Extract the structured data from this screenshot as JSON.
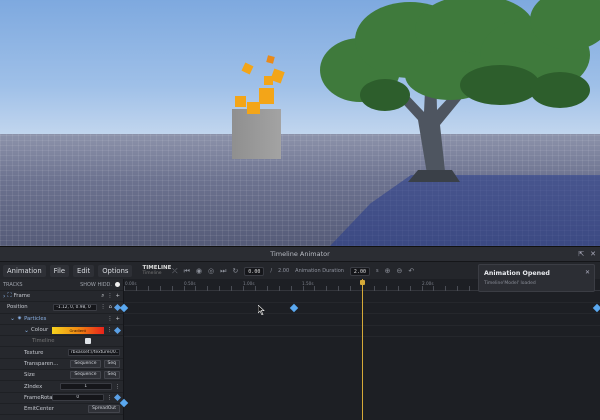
{
  "window": {
    "title": "Timeline Animator"
  },
  "menu": [
    "Animation",
    "File",
    "Edit",
    "Options"
  ],
  "timeline_label": {
    "title": "TIMELINE",
    "subtitle": "Timeline"
  },
  "transport": {
    "current_time": "0.00",
    "separator": "/",
    "total_time": "2.00",
    "duration_label": "Animation Duration",
    "duration_value": "2.00",
    "duration_unit": "s"
  },
  "tracks": {
    "header": "TRACKS",
    "show_hidden": "SHOW HIDD.",
    "frame": "Frame",
    "position": {
      "label": "Position",
      "value": "-1.12, 0, 0.98, 0"
    },
    "particles": "Particles",
    "colour": {
      "label": "Colour",
      "value": "Gradient"
    },
    "timeline_sub": "Timeline",
    "texture": {
      "label": "Texture",
      "value": "rbxasset://textures/0..."
    },
    "transparency": {
      "label": "Transparen...",
      "btn1": "Sequence",
      "btn2": "Seq"
    },
    "size": {
      "label": "Size",
      "btn1": "Sequence",
      "btn2": "Seq"
    },
    "zindex": {
      "label": "ZIndex",
      "value": "1"
    },
    "framerotation": {
      "label": "FrameRota...",
      "value": "0"
    },
    "last": {
      "label": "EmitCenter",
      "value": "SpreadOut"
    }
  },
  "ruler": [
    "0.00s",
    "0.50s",
    "1.00s",
    "1.50s",
    "2.00s"
  ],
  "toast": {
    "title": "Animation Opened",
    "subtitle": "Timeline'Model' loaded"
  },
  "colors": {
    "accent": "#5aa8f0",
    "playhead": "#d5a938"
  }
}
